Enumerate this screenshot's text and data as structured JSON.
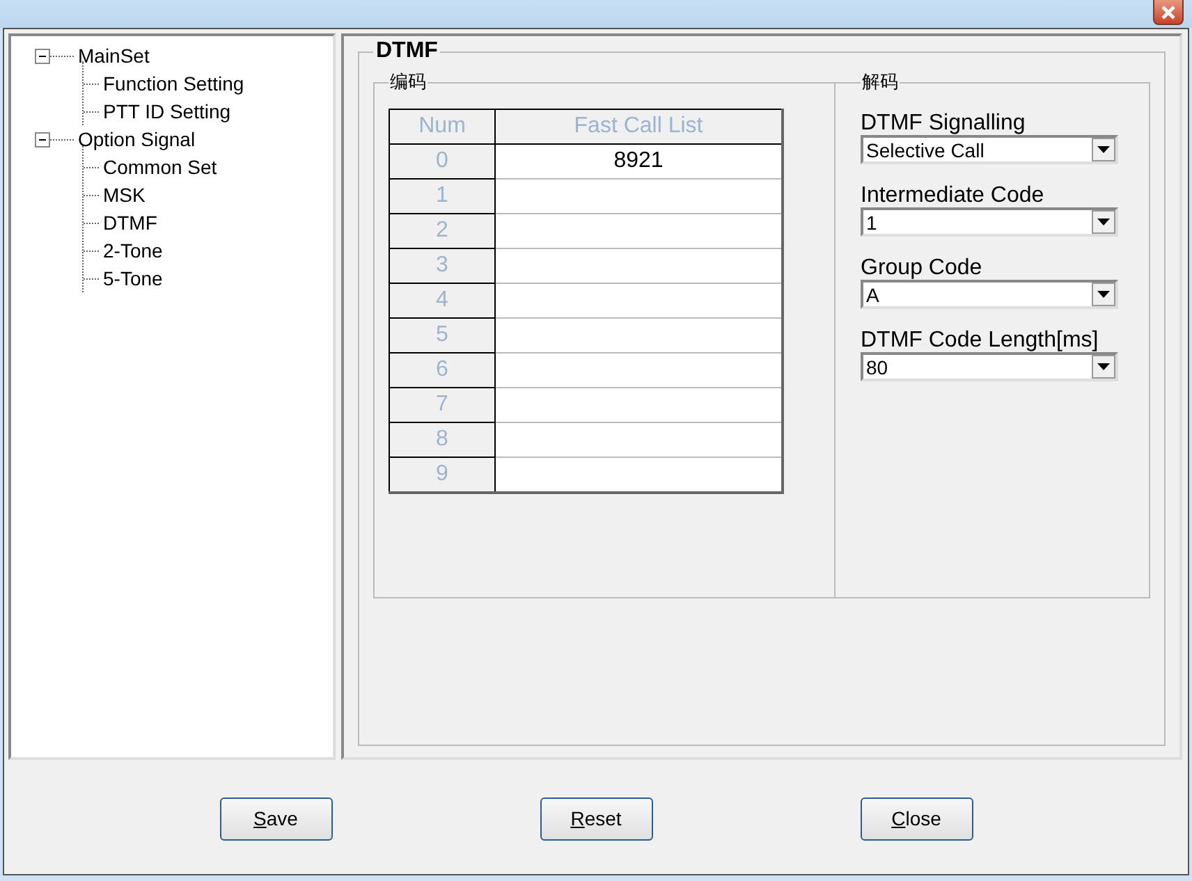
{
  "tree": [
    {
      "label": "MainSet",
      "expanded": true,
      "children": [
        {
          "label": "Function Setting"
        },
        {
          "label": "PTT ID Setting"
        }
      ]
    },
    {
      "label": "Option Signal",
      "expanded": true,
      "children": [
        {
          "label": "Common Set"
        },
        {
          "label": "MSK"
        },
        {
          "label": "DTMF"
        },
        {
          "label": "2-Tone"
        },
        {
          "label": "5-Tone"
        }
      ]
    }
  ],
  "panel": {
    "title": "DTMF",
    "encode": {
      "title": "编码",
      "columns": [
        "Num",
        "Fast Call List"
      ],
      "rows": [
        {
          "num": "0",
          "value": "8921"
        },
        {
          "num": "1"
        },
        {
          "num": "2"
        },
        {
          "num": "3"
        },
        {
          "num": "4"
        },
        {
          "num": "5"
        },
        {
          "num": "6"
        },
        {
          "num": "7"
        },
        {
          "num": "8"
        },
        {
          "num": "9"
        }
      ]
    },
    "decode": {
      "title": "解码",
      "fields": [
        {
          "label": "DTMF Signalling",
          "value": "Selective Call"
        },
        {
          "label": "Intermediate Code",
          "value": "1"
        },
        {
          "label": "Group Code",
          "value": "A"
        },
        {
          "label": "DTMF Code Length[ms]",
          "value": "80"
        }
      ]
    }
  },
  "buttons": [
    {
      "mnemonic": "S",
      "rest": "ave"
    },
    {
      "mnemonic": "R",
      "rest": "eset"
    },
    {
      "mnemonic": "C",
      "rest": "lose"
    }
  ]
}
